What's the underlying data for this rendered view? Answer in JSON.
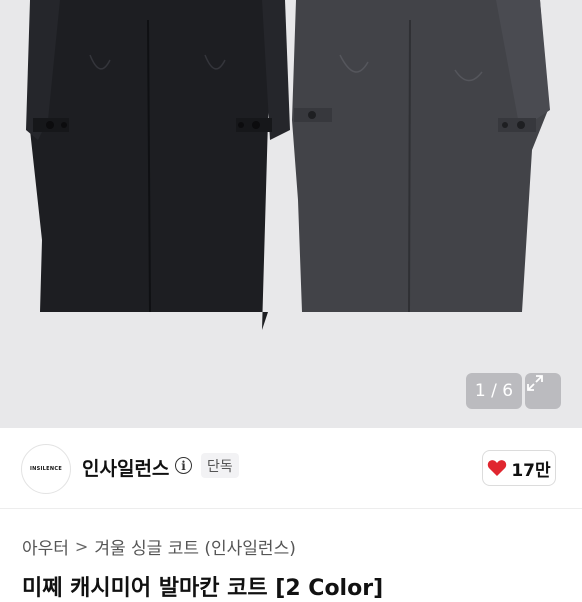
{
  "gallery": {
    "counter": "1 / 6",
    "expand_icon": "expand-arrows-icon"
  },
  "shop": {
    "logo_text": "INSILENCE",
    "name": "인사일런스",
    "info_icon": "i",
    "badge": "단독"
  },
  "like": {
    "icon": "heart-icon",
    "count": "17만",
    "color": "#e0262f"
  },
  "breadcrumb": {
    "items": [
      "아우터",
      "겨울 싱글 코트 (인사일런스)"
    ],
    "separator": ">"
  },
  "product": {
    "title": "미쩨 캐시미어 발마칸 코트 [2 Color]"
  }
}
